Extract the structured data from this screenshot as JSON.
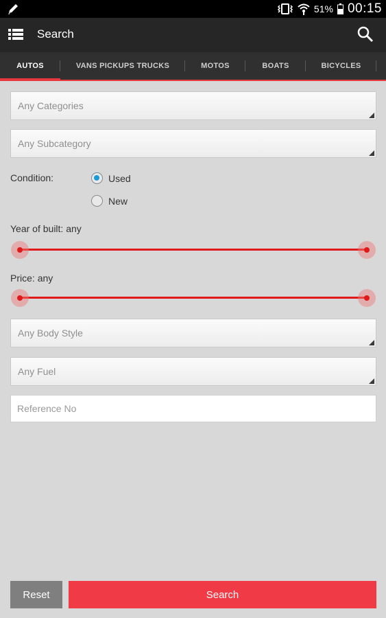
{
  "status_bar": {
    "battery": "51%",
    "time": "00:15",
    "icons": [
      "pencil-icon",
      "vibrate-icon",
      "wifi-icon",
      "battery-icon"
    ]
  },
  "app_bar": {
    "title": "Search",
    "icons": [
      "menu-icon",
      "search-icon"
    ]
  },
  "tabs": [
    {
      "label": "AUTOS",
      "active": true
    },
    {
      "label": "VANS PICKUPS TRUCKS",
      "active": false
    },
    {
      "label": "MOTOS",
      "active": false
    },
    {
      "label": "BOATS",
      "active": false
    },
    {
      "label": "BICYCLES",
      "active": false
    }
  ],
  "form": {
    "category": "Any Categories",
    "subcategory": "Any Subcategory",
    "condition_label": "Condition:",
    "condition_options": [
      {
        "label": "Used",
        "selected": true
      },
      {
        "label": "New",
        "selected": false
      }
    ],
    "year_label": "Year of built:",
    "year_value": "any",
    "year_range": {
      "low": 0,
      "high": 1
    },
    "price_label": "Price:",
    "price_value": "any",
    "price_range": {
      "low": 0,
      "high": 1
    },
    "body_style": "Any Body Style",
    "fuel": "Any Fuel",
    "reference_placeholder": "Reference No",
    "reference_value": ""
  },
  "buttons": {
    "reset": "Reset",
    "search": "Search"
  },
  "colors": {
    "accent": "#e8393f",
    "search_button": "#f03a45",
    "reset_button": "#7f7f7f",
    "radio_selected": "#1a9bd7"
  }
}
